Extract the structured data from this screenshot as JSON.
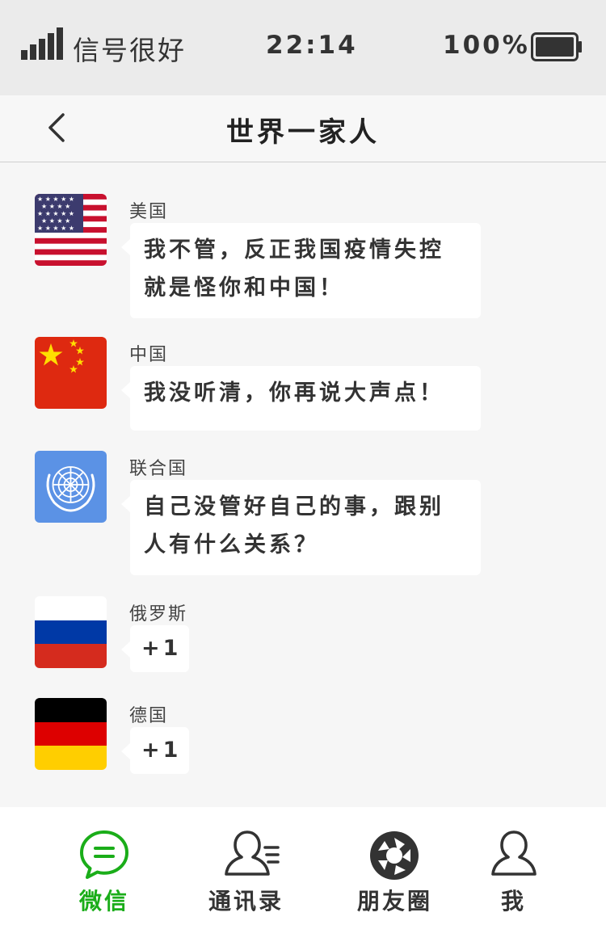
{
  "status_bar": {
    "signal_text": "信号很好",
    "time": "22:14",
    "battery": "100%",
    "icons": [
      "signal-bars-icon",
      "battery-icon"
    ]
  },
  "nav": {
    "title": "世界一家人",
    "back_icon": "chevron-left-icon"
  },
  "messages": [
    {
      "sender": "美国",
      "avatar": "us-flag",
      "text": "我不管，反正我国疫情失控就是怪你和中国！"
    },
    {
      "sender": "中国",
      "avatar": "china-flag",
      "text": "我没听清，你再说大声点！"
    },
    {
      "sender": "联合国",
      "avatar": "un-emblem",
      "text": "自己没管好自己的事，跟别人有什么关系？"
    },
    {
      "sender": "俄罗斯",
      "avatar": "russia-flag",
      "text": "+1"
    },
    {
      "sender": "德国",
      "avatar": "germany-flag",
      "text": "+1"
    }
  ],
  "tabs": [
    {
      "label": "微信",
      "icon": "chat-bubble-icon",
      "active": true
    },
    {
      "label": "通讯录",
      "icon": "contacts-icon",
      "active": false
    },
    {
      "label": "朋友圈",
      "icon": "aperture-icon",
      "active": false
    },
    {
      "label": "我",
      "icon": "person-icon",
      "active": false
    }
  ],
  "colors": {
    "accent": "#1aad19",
    "tab_inactive": "#333333",
    "status_bar_bg": "#ebebeb",
    "chat_bg": "#f6f6f6",
    "bubble_bg": "#ffffff"
  }
}
